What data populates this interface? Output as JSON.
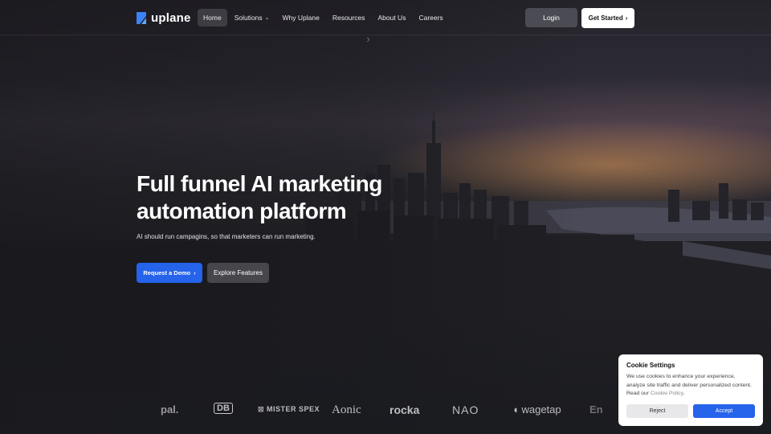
{
  "brand": {
    "name": "uplane",
    "accent": "#2563eb"
  },
  "nav": {
    "items": [
      {
        "label": "Home",
        "active": true
      },
      {
        "label": "Solutions",
        "has_dropdown": true
      },
      {
        "label": "Why Uplane"
      },
      {
        "label": "Resources"
      },
      {
        "label": "About Us"
      },
      {
        "label": "Careers"
      }
    ],
    "login_label": "Login",
    "get_started_label": "Get Started"
  },
  "hero": {
    "title_line1": "Full funnel AI marketing",
    "title_line2": "automation platform",
    "subtitle": "AI should run campagins, so that marketers can run marketing.",
    "primary_cta": "Request a Demo",
    "secondary_cta": "Explore Features"
  },
  "logos": [
    "pal.",
    "DB",
    "MISTER SPEX",
    "Aonic",
    "rocka",
    "NAO",
    "wagetap",
    "En"
  ],
  "cookie": {
    "title": "Cookie Settings",
    "text": "We use cookies to enhance your experience, analyze site traffic and deliver personalized content. Read our",
    "link_label": "Cookie Policy",
    "trailing": ".",
    "reject_label": "Reject",
    "accept_label": "Accept"
  }
}
